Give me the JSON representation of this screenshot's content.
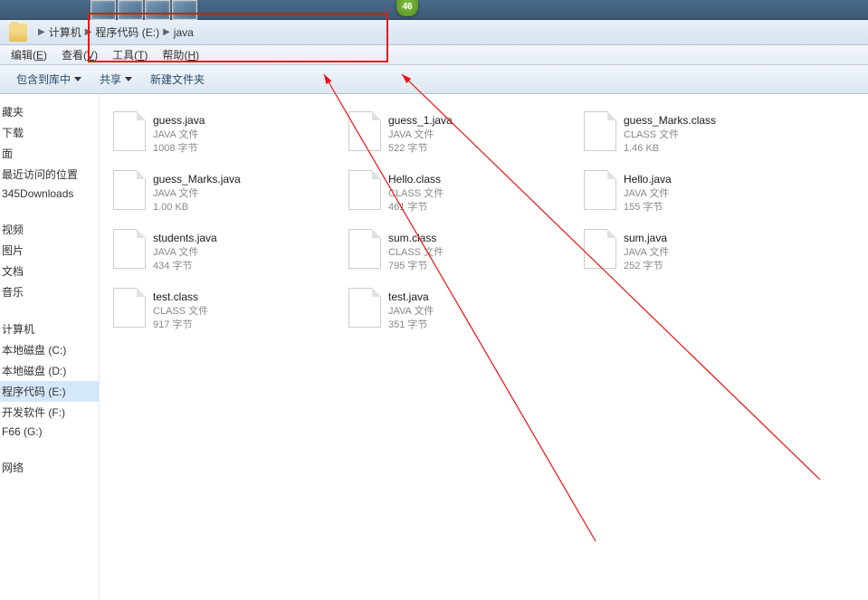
{
  "titlebar": {
    "badge_value": "46"
  },
  "breadcrumbs": [
    {
      "label": "计算机"
    },
    {
      "label": "程序代码 (E:)"
    },
    {
      "label": "java"
    }
  ],
  "menu": {
    "edit": {
      "label": "编辑",
      "key": "E"
    },
    "view": {
      "label": "查看",
      "key": "V"
    },
    "tools": {
      "label": "工具",
      "key": "T"
    },
    "help": {
      "label": "帮助",
      "key": "H"
    }
  },
  "toolbar": {
    "include_library": "包含到库中",
    "share": "共享",
    "new_folder": "新建文件夹"
  },
  "sidebar": {
    "favs": [
      "藏夹",
      "下载",
      "面",
      "最近访问的位置",
      "345Downloads"
    ],
    "lib": [
      "视频",
      "图片",
      "文档",
      "音乐"
    ],
    "drives": [
      {
        "label": "计算机",
        "sel": false
      },
      {
        "label": "本地磁盘 (C:)",
        "sel": false
      },
      {
        "label": "本地磁盘 (D:)",
        "sel": false
      },
      {
        "label": "程序代码 (E:)",
        "sel": true
      },
      {
        "label": "开发软件 (F:)",
        "sel": false
      },
      {
        "label": "F66 (G:)",
        "sel": false
      }
    ],
    "net": [
      "网络"
    ]
  },
  "files": [
    {
      "name": "guess.java",
      "type": "JAVA 文件",
      "size": "1008 字节"
    },
    {
      "name": "guess_1.java",
      "type": "JAVA 文件",
      "size": "522 字节"
    },
    {
      "name": "guess_Marks.class",
      "type": "CLASS 文件",
      "size": "1.46 KB"
    },
    {
      "name": "guess_Marks.java",
      "type": "JAVA 文件",
      "size": "1.00 KB"
    },
    {
      "name": "Hello.class",
      "type": "CLASS 文件",
      "size": "461 字节"
    },
    {
      "name": "Hello.java",
      "type": "JAVA 文件",
      "size": "155 字节"
    },
    {
      "name": "students.java",
      "type": "JAVA 文件",
      "size": "434 字节"
    },
    {
      "name": "sum.class",
      "type": "CLASS 文件",
      "size": "795 字节"
    },
    {
      "name": "sum.java",
      "type": "JAVA 文件",
      "size": "252 字节"
    },
    {
      "name": "test.class",
      "type": "CLASS 文件",
      "size": "917 字节"
    },
    {
      "name": "test.java",
      "type": "JAVA 文件",
      "size": "351 字节"
    }
  ]
}
